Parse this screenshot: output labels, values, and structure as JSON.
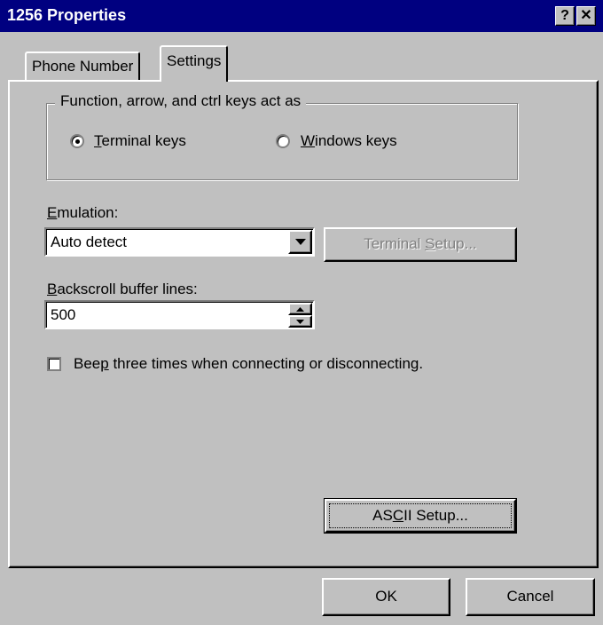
{
  "window": {
    "title": "1256 Properties",
    "help_glyph": "?",
    "close_glyph": "✕"
  },
  "tabs": [
    {
      "label": "Phone Number",
      "active": false
    },
    {
      "label": "Settings",
      "active": true
    }
  ],
  "keys_group": {
    "label": "Function, arrow, and ctrl keys act as",
    "options": [
      {
        "label_prefix": "",
        "label_mnemonic": "T",
        "label_rest": "erminal keys",
        "selected": true
      },
      {
        "label_prefix": "",
        "label_mnemonic": "W",
        "label_rest": "indows keys",
        "selected": false
      }
    ]
  },
  "emulation": {
    "label_mnemonic": "E",
    "label_rest": "mulation:",
    "value": "Auto detect",
    "terminal_setup": {
      "prefix": "Terminal ",
      "mnemonic": "S",
      "rest": "etup...",
      "enabled": false
    }
  },
  "backscroll": {
    "label_mnemonic": "B",
    "label_rest": "ackscroll buffer lines:",
    "value": "500"
  },
  "beep": {
    "label_prefix": "Bee",
    "label_mnemonic": "p",
    "label_rest": " three times when connecting or disconnecting.",
    "checked": false
  },
  "ascii_setup": {
    "prefix": "AS",
    "mnemonic": "C",
    "rest": "II Setup..."
  },
  "footer": {
    "ok_label": "OK",
    "cancel_label": "Cancel"
  }
}
